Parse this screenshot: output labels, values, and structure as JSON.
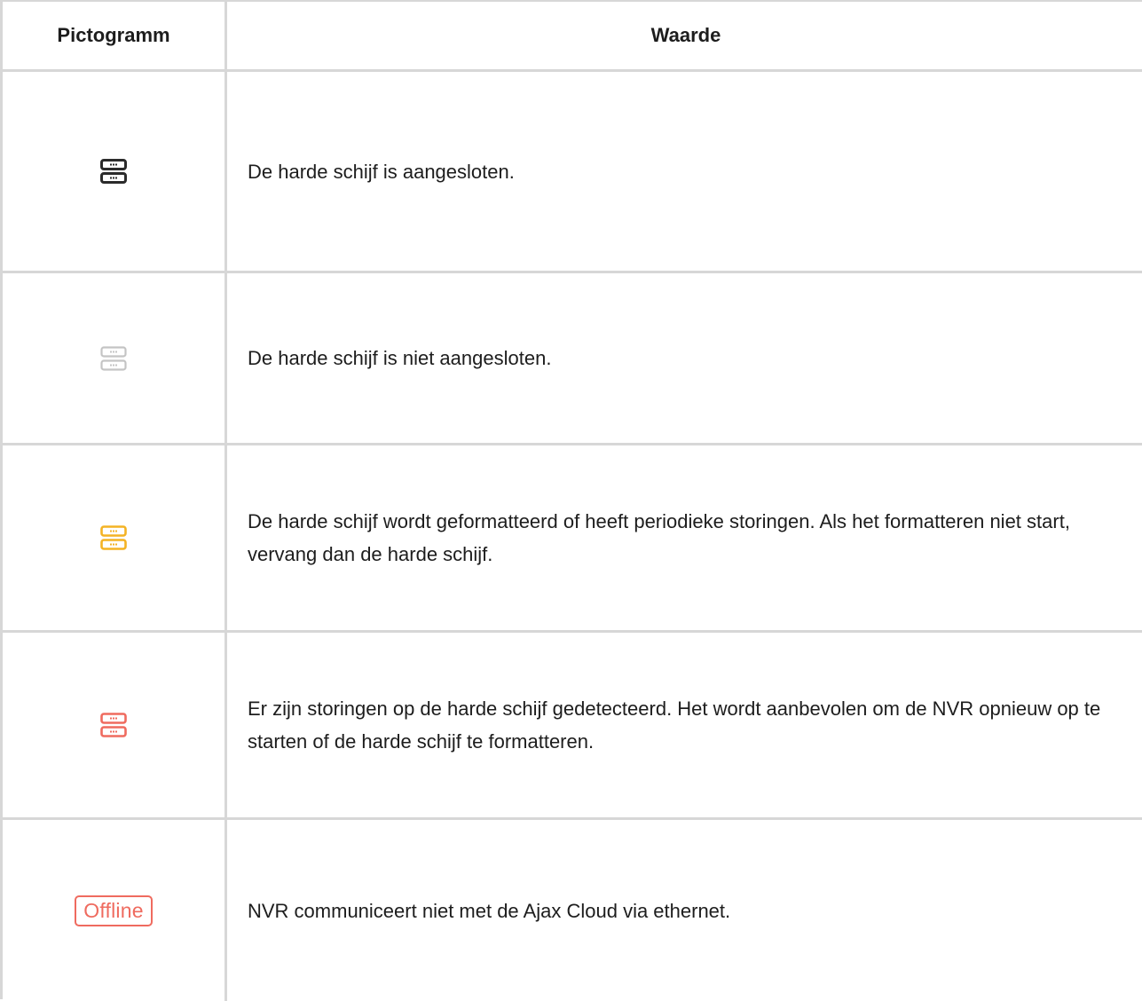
{
  "table": {
    "header": {
      "icon_col": "Pictogramm",
      "value_col": "Waarde"
    },
    "rows": [
      {
        "icon": "hdd-connected-icon",
        "color": "#2b2b2b",
        "text": "De harde schijf is aangesloten."
      },
      {
        "icon": "hdd-disconnected-icon",
        "color": "#c4c4c4",
        "text": "De harde schijf is niet aangesloten."
      },
      {
        "icon": "hdd-warning-icon",
        "color": "#f4b324",
        "text": "De harde schijf wordt geformatteerd of heeft periodieke storingen. Als het formatteren niet start, vervang dan de harde schijf."
      },
      {
        "icon": "hdd-error-icon",
        "color": "#ef6b5f",
        "text": "Er zijn storingen op de harde schijf gedetecteerd. Het wordt aanbevolen om de NVR opnieuw op te starten of de harde schijf te formatteren."
      },
      {
        "icon": "offline-badge",
        "color": "#ef6b5f",
        "badge": "Offline",
        "text": "NVR communiceert niet met de Ajax Cloud via ethernet."
      }
    ]
  }
}
